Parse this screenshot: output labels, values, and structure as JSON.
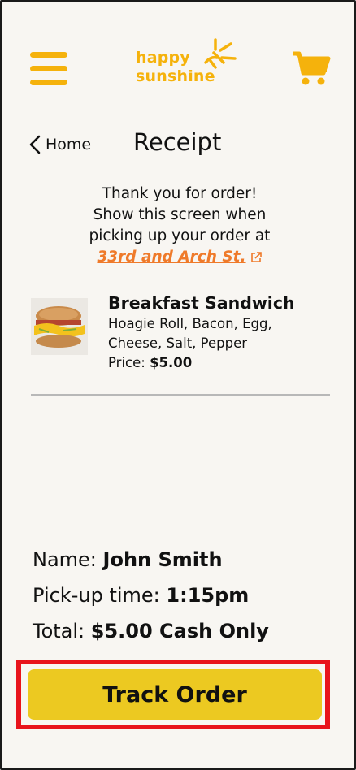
{
  "header": {
    "logo_line1": "happy",
    "logo_line2": "sunshine",
    "brand_color": "#f5b20c",
    "icons": [
      "hamburger-menu-icon",
      "sun-logo-icon",
      "cart-icon"
    ]
  },
  "nav": {
    "back_label": "Home",
    "title": "Receipt"
  },
  "message": {
    "line1": "Thank you for order!",
    "line2": "Show this screen when",
    "line3": "picking up your order at",
    "location": "33rd and Arch St.",
    "location_color": "#ef7a2a"
  },
  "item": {
    "name": "Breakfast Sandwich",
    "desc_line1": "Hoagie Roll, Bacon, Egg,",
    "desc_line2": "Cheese, Salt, Pepper",
    "price_label": "Price:",
    "price_value": "$5.00"
  },
  "summary": {
    "name_label": "Name:",
    "name_value": "John Smith",
    "pickup_label": "Pick-up time:",
    "pickup_value": "1:15pm",
    "total_label": "Total:",
    "total_value": "$5.00 Cash Only"
  },
  "actions": {
    "track_label": "Track Order",
    "track_color": "#ecc921",
    "highlight_color": "#e8141c"
  }
}
